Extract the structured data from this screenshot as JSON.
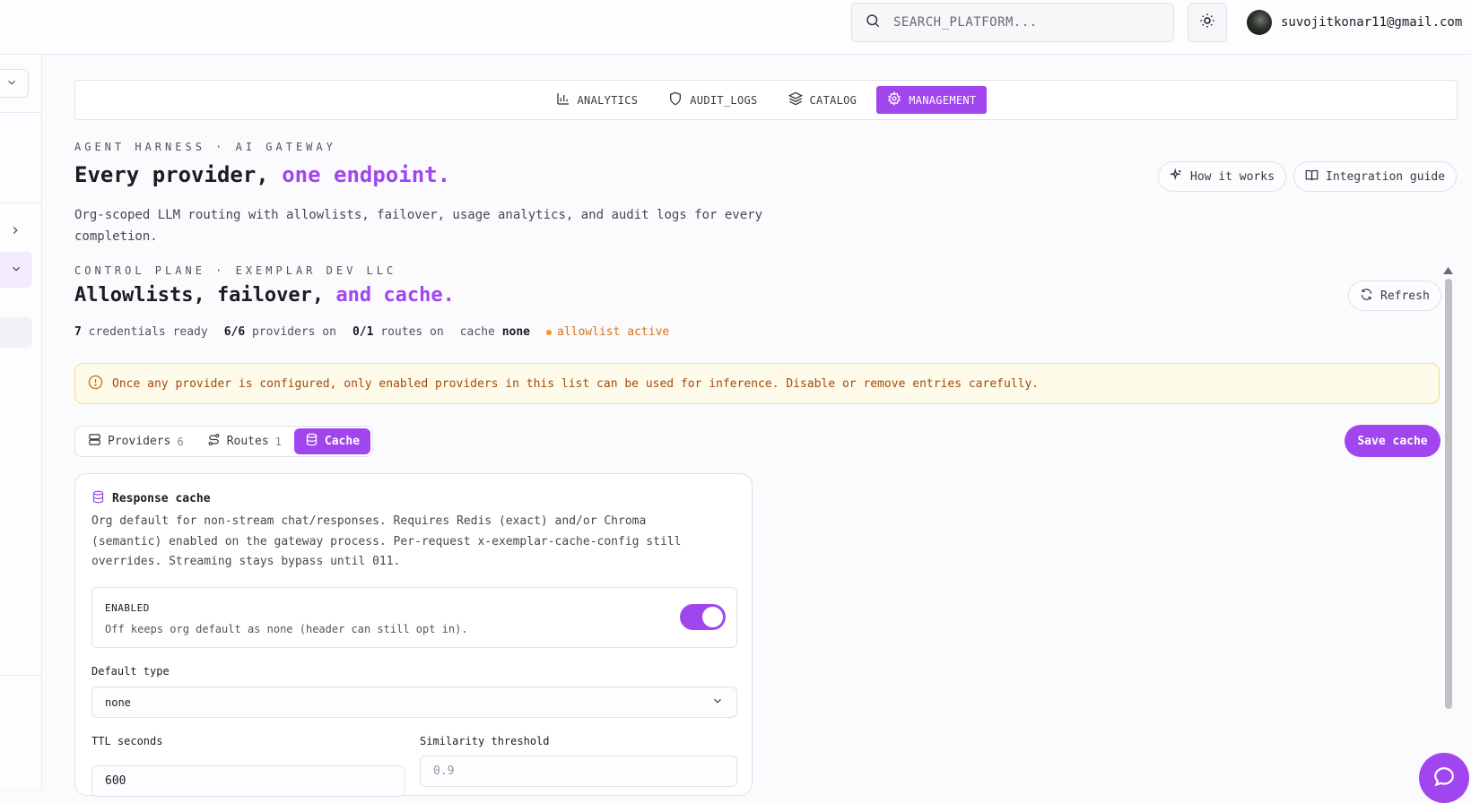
{
  "topbar": {
    "search_placeholder": "SEARCH_PLATFORM...",
    "user_email": "suvojitkonar11@gmail.com"
  },
  "nav": {
    "tabs": [
      {
        "label": "ANALYTICS",
        "icon": "bar-chart-icon",
        "active": false
      },
      {
        "label": "AUDIT_LOGS",
        "icon": "shield-icon",
        "active": false
      },
      {
        "label": "CATALOG",
        "icon": "layers-icon",
        "active": false
      },
      {
        "label": "MANAGEMENT",
        "icon": "gear-icon",
        "active": true
      }
    ]
  },
  "hero": {
    "eyebrow": "AGENT HARNESS · AI GATEWAY",
    "title_plain": "Every provider,",
    "title_accent": "one endpoint.",
    "description": "Org-scoped LLM routing with allowlists, failover, usage analytics, and audit logs for every completion.",
    "how_it_works": "How it works",
    "integration_guide": "Integration guide"
  },
  "control": {
    "eyebrow": "CONTROL PLANE · EXEMPLAR DEV LLC",
    "title_plain": "Allowlists, failover,",
    "title_accent": "and cache.",
    "refresh": "Refresh",
    "stats": {
      "credentials_count": "7",
      "credentials_text": "credentials ready",
      "providers_count": "6/6",
      "providers_text": "providers on",
      "routes_count": "0/1",
      "routes_text": "routes on",
      "cache_text": "cache",
      "cache_value": "none",
      "allowlist": "allowlist active"
    },
    "alert": "Once any provider is configured, only enabled providers in this list can be used for inference. Disable or remove entries carefully."
  },
  "segments": [
    {
      "label": "Providers",
      "count": "6",
      "icon": "server-icon",
      "active": false
    },
    {
      "label": "Routes",
      "count": "1",
      "icon": "route-icon",
      "active": false
    },
    {
      "label": "Cache",
      "count": "",
      "icon": "database-icon",
      "active": true
    }
  ],
  "save_button": "Save cache",
  "cache": {
    "title": "Response cache",
    "description": "Org default for non-stream chat/responses. Requires Redis (exact) and/or Chroma (semantic) enabled on the gateway process. Per-request x-exemplar-cache-config still overrides. Streaming stays bypass until 011.",
    "enabled_label": "ENABLED",
    "enabled_help": "Off keeps org default as none (header can still opt in).",
    "enabled": true,
    "default_type_label": "Default type",
    "default_type_value": "none",
    "ttl_label": "TTL seconds",
    "ttl_value": "600",
    "similarity_label": "Similarity threshold",
    "similarity_placeholder": "0.9"
  },
  "colors": {
    "accent": "#a146ef",
    "warning_bg": "#fffbea",
    "warning_text": "#a14a0b"
  }
}
